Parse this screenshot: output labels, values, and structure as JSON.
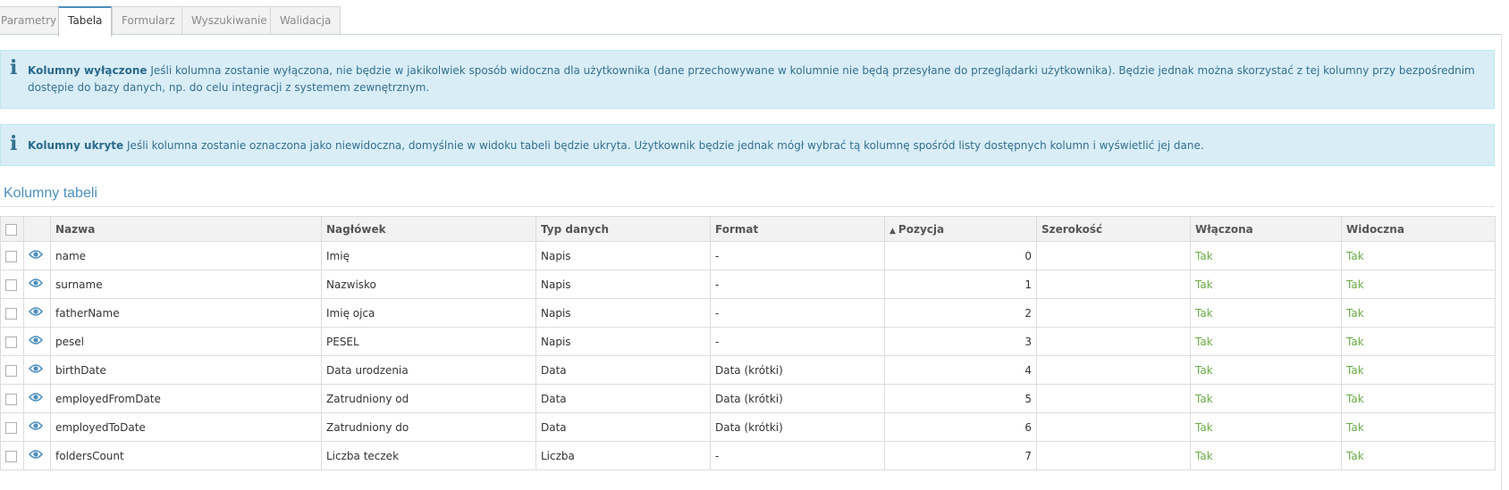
{
  "tabs": [
    {
      "label": "Parametry",
      "active": false
    },
    {
      "label": "Tabela",
      "active": true
    },
    {
      "label": "Formularz",
      "active": false
    },
    {
      "label": "Wyszukiwanie",
      "active": false
    },
    {
      "label": "Walidacja",
      "active": false
    }
  ],
  "alerts": {
    "disabled": {
      "title": "Kolumny wyłączone",
      "text": "Jeśli kolumna zostanie wyłączona, nie będzie w jakikolwiek sposób widoczna dla użytkownika (dane przechowywane w kolumnie nie będą przesyłane do przeglądarki użytkownika). Będzie jednak można skorzystać z tej kolumny przy bezpośrednim dostępie do bazy danych, np. do celu integracji z systemem zewnętrznym."
    },
    "hidden": {
      "title": "Kolumny ukryte",
      "text": "Jeśli kolumna zostanie oznaczona jako niewidoczna, domyślnie w widoku tabeli będzie ukryta. Użytkownik będzie jednak mógł wybrać tą kolumnę spośród listy dostępnych kolumn i wyświetlić jej dane."
    }
  },
  "section": {
    "title": "Kolumny tabeli"
  },
  "table": {
    "headers": {
      "name": "Nazwa",
      "header": "Nagłówek",
      "type": "Typ danych",
      "format": "Format",
      "position": "Pozycja",
      "width": "Szerokość",
      "enabled": "Włączona",
      "visible": "Widoczna"
    },
    "sort": {
      "column": "position",
      "direction": "asc"
    },
    "rows": [
      {
        "name": "name",
        "header": "Imię",
        "type": "Napis",
        "format": "-",
        "position": "0",
        "width": "",
        "enabled": "Tak",
        "visible": "Tak"
      },
      {
        "name": "surname",
        "header": "Nazwisko",
        "type": "Napis",
        "format": "-",
        "position": "1",
        "width": "",
        "enabled": "Tak",
        "visible": "Tak"
      },
      {
        "name": "fatherName",
        "header": "Imię ojca",
        "type": "Napis",
        "format": "-",
        "position": "2",
        "width": "",
        "enabled": "Tak",
        "visible": "Tak"
      },
      {
        "name": "pesel",
        "header": "PESEL",
        "type": "Napis",
        "format": "-",
        "position": "3",
        "width": "",
        "enabled": "Tak",
        "visible": "Tak"
      },
      {
        "name": "birthDate",
        "header": "Data urodzenia",
        "type": "Data",
        "format": "Data (krótki)",
        "position": "4",
        "width": "",
        "enabled": "Tak",
        "visible": "Tak"
      },
      {
        "name": "employedFromDate",
        "header": "Zatrudniony od",
        "type": "Data",
        "format": "Data (krótki)",
        "position": "5",
        "width": "",
        "enabled": "Tak",
        "visible": "Tak"
      },
      {
        "name": "employedToDate",
        "header": "Zatrudniony do",
        "type": "Data",
        "format": "Data (krótki)",
        "position": "6",
        "width": "",
        "enabled": "Tak",
        "visible": "Tak"
      },
      {
        "name": "foldersCount",
        "header": "Liczba teczek",
        "type": "Liczba",
        "format": "-",
        "position": "7",
        "width": "",
        "enabled": "Tak",
        "visible": "Tak"
      }
    ]
  },
  "colors": {
    "accent": "#4c8fbd",
    "info_bg": "#d9edf7",
    "info_text": "#31708f",
    "yes": "#69aa46"
  },
  "icons": {
    "info": "info-icon",
    "row_action": "eye-icon",
    "sort": "sort-asc-icon"
  }
}
